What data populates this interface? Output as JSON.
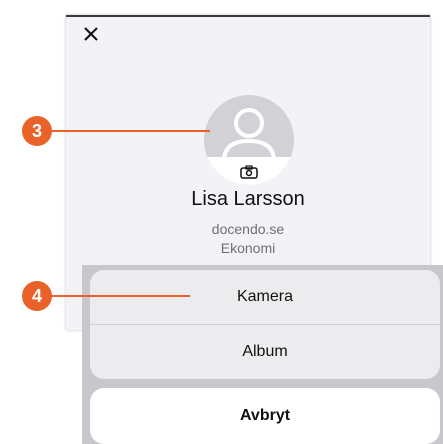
{
  "profile": {
    "name": "Lisa Larsson",
    "domain": "docendo.se",
    "department": "Ekonomi"
  },
  "action_sheet": {
    "items": [
      {
        "label": "Kamera"
      },
      {
        "label": "Album"
      }
    ],
    "cancel_label": "Avbryt"
  },
  "callouts": [
    {
      "number": "3"
    },
    {
      "number": "4"
    }
  ],
  "icons": {
    "close": "close-icon",
    "avatar": "person-placeholder",
    "camera": "camera-icon"
  },
  "colors": {
    "callout": "#e8622a",
    "panel_bg": "#f2f2f7",
    "avatar_bg": "#d1d1d6"
  }
}
